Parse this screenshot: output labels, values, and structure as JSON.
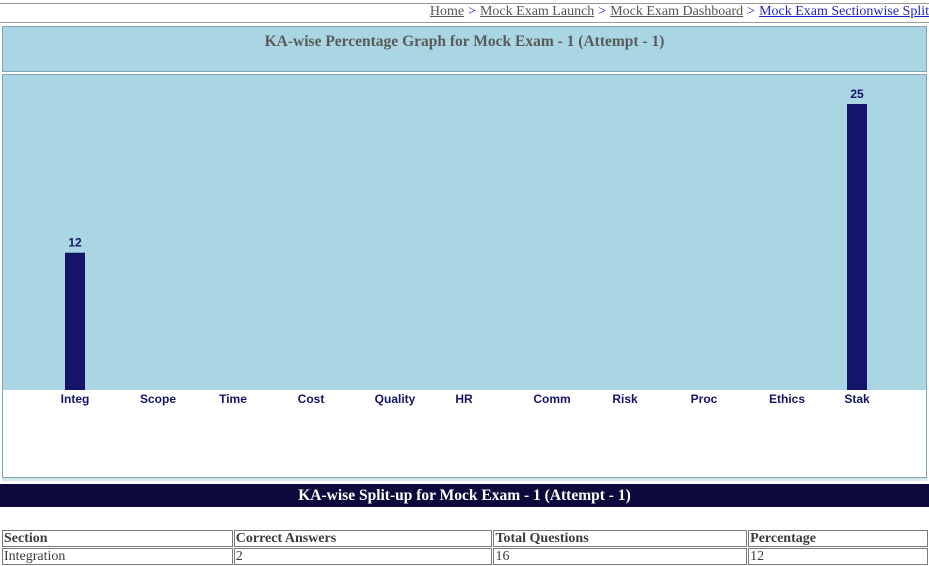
{
  "breadcrumb": {
    "items": [
      "Home",
      "Mock Exam Launch",
      "Mock Exam Dashboard",
      "Mock Exam Sectionwise Split"
    ],
    "separator": ">"
  },
  "graph_title": "KA-wise Percentage Graph for Mock Exam - 1 (Attempt - 1)",
  "split_title": "KA-wise Split-up for Mock Exam - 1 (Attempt - 1)",
  "table": {
    "headers": [
      "Section",
      "Correct Answers",
      "Total Questions",
      "Percentage"
    ],
    "rows": [
      [
        "Integration",
        "2",
        "16",
        "12"
      ]
    ]
  },
  "chart_data": {
    "type": "bar",
    "categories": [
      "Integ",
      "Scope",
      "Time",
      "Cost",
      "Quality",
      "HR",
      "Comm",
      "Risk",
      "Proc",
      "Ethics",
      "Stak"
    ],
    "values": [
      12,
      0,
      0,
      0,
      0,
      0,
      0,
      0,
      0,
      0,
      25
    ],
    "value_labels_shown": [
      true,
      false,
      false,
      false,
      false,
      false,
      false,
      false,
      false,
      false,
      true
    ],
    "ylim": [
      0,
      25
    ],
    "grid": false,
    "colors": {
      "bar": "#141469",
      "plot_background": "#aad6e4",
      "label": "#141469"
    }
  }
}
